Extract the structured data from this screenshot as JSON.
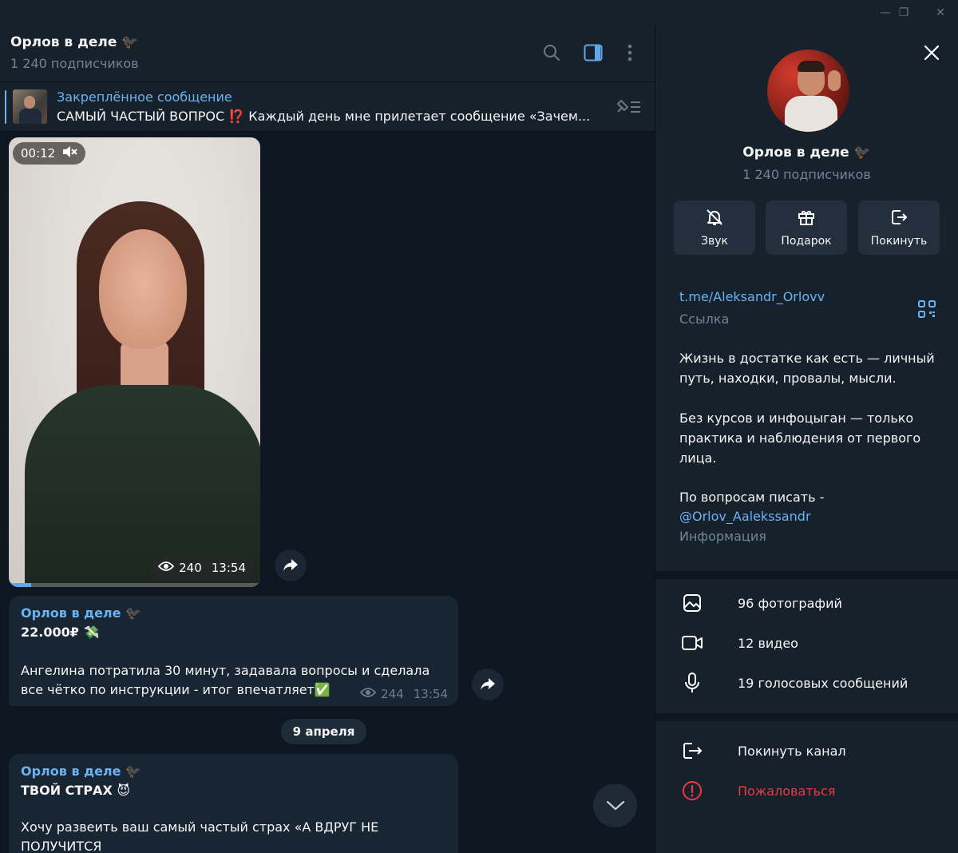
{
  "window": {
    "minimize": "—",
    "restore": "❐",
    "close": "✕"
  },
  "chat": {
    "title": "Орлов в деле 🐦‍⬛",
    "subscribers": "1 240 подписчиков"
  },
  "pinned": {
    "title": "Закреплённое сообщение",
    "text": "САМЫЙ ЧАСТЫЙ ВОПРОС ⁉️ Каждый день мне прилетает сообщение «Зачем..."
  },
  "video": {
    "duration": "00:12",
    "views": "240",
    "time": "13:54",
    "progress": 0.09
  },
  "post1": {
    "author": "Орлов в деле 🐦‍⬛",
    "headline": "22.000₽ 💸",
    "body": "Ангелина потратила 30 минут, задавала вопросы и сделала все чётко по инструкции - итог впечатляет✅",
    "views": "244",
    "time": "13:54"
  },
  "date_separator": "9 апреля",
  "post2": {
    "author": "Орлов в деле 🐦‍⬛",
    "headline": "ТВОЙ СТРАХ 😈",
    "body": "Хочу развеить ваш самый частый страх «А ВДРУГ НЕ ПОЛУЧИТСЯ"
  },
  "panel": {
    "name": "Орлов в деле 🐦‍⬛",
    "subscribers": "1 240 подписчиков",
    "actions": [
      {
        "label": "Звук",
        "icon": "bell-off-icon"
      },
      {
        "label": "Подарок",
        "icon": "gift-icon"
      },
      {
        "label": "Покинуть",
        "icon": "leave-icon"
      }
    ],
    "link": "t.me/Aleksandr_Orlovv",
    "link_caption": "Ссылка",
    "about_p1": "Жизнь в достатке как есть — личный путь, находки, провалы, мысли.",
    "about_p2": "Без курсов и инфоцыган — только практика и наблюдения от первого лица.",
    "about_p3": "По вопросам писать -",
    "about_contact": "@Orlov_Aalekssandr",
    "about_caption": "Информация",
    "media": [
      {
        "label": "96 фотографий",
        "icon": "photo-icon"
      },
      {
        "label": "12 видео",
        "icon": "video-icon"
      },
      {
        "label": "19 голосовых сообщений",
        "icon": "microphone-icon"
      }
    ],
    "leave_channel": "Покинуть канал",
    "report": "Пожаловаться"
  },
  "colors": {
    "accent": "#6ab3f3",
    "danger": "#ec3942",
    "bg": "#0e1621",
    "panel": "#17212b"
  }
}
